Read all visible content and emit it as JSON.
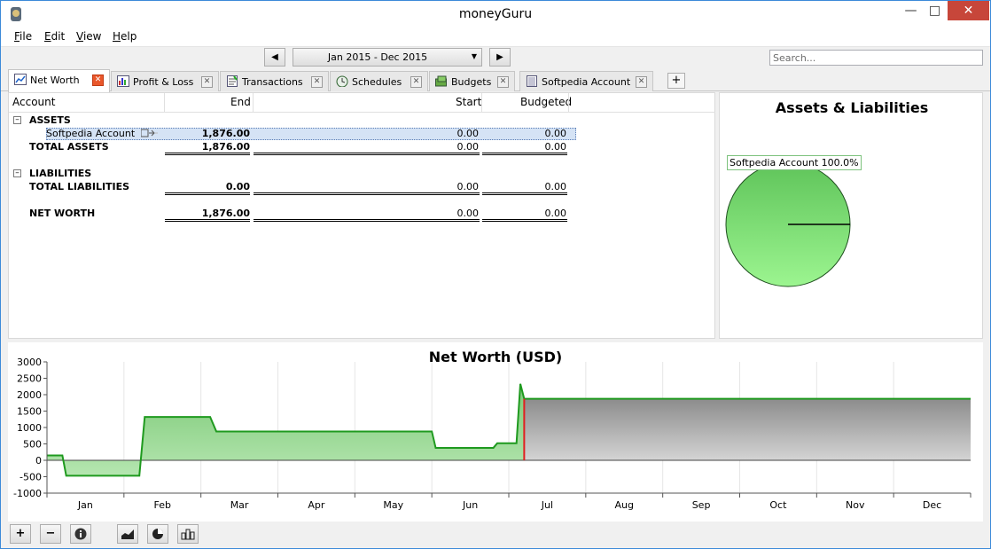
{
  "window": {
    "title": "moneyGuru"
  },
  "menu": [
    {
      "label": "File",
      "mnemonic": "F",
      "rest": "ile"
    },
    {
      "label": "Edit",
      "mnemonic": "E",
      "rest": "dit"
    },
    {
      "label": "View",
      "mnemonic": "V",
      "rest": "iew"
    },
    {
      "label": "Help",
      "mnemonic": "H",
      "rest": "elp"
    }
  ],
  "toolbar": {
    "date_range": "Jan 2015 - Dec 2015",
    "prev_glyph": "◀",
    "next_glyph": "▶",
    "search_placeholder": "Search..."
  },
  "tabs": [
    {
      "label": "Net Worth",
      "icon": "net-worth-icon",
      "active": true
    },
    {
      "label": "Profit & Loss",
      "icon": "profit-loss-icon",
      "active": false
    },
    {
      "label": "Transactions",
      "icon": "transactions-icon",
      "active": false
    },
    {
      "label": "Schedules",
      "icon": "schedules-icon",
      "active": false
    },
    {
      "label": "Budgets",
      "icon": "budgets-icon",
      "active": false
    },
    {
      "label": "Softpedia Account",
      "icon": "account-icon",
      "active": false
    }
  ],
  "sheet": {
    "columns": {
      "account": "Account",
      "end": "End",
      "start": "Start",
      "budgeted": "Budgeted"
    },
    "assets": {
      "group": "ASSETS",
      "accounts": [
        {
          "name": "Softpedia Account",
          "end": "1,876.00",
          "start": "0.00",
          "budgeted": "0.00"
        }
      ],
      "total": {
        "label": "TOTAL ASSETS",
        "end": "1,876.00",
        "start": "0.00",
        "budgeted": "0.00"
      }
    },
    "liabilities": {
      "group": "LIABILITIES",
      "total": {
        "label": "TOTAL LIABILITIES",
        "end": "0.00",
        "start": "0.00",
        "budgeted": "0.00"
      }
    },
    "net_worth": {
      "label": "NET WORTH",
      "end": "1,876.00",
      "start": "0.00",
      "budgeted": "0.00"
    }
  },
  "pie_chart": {
    "title": "Assets & Liabilities",
    "label": "Softpedia Account 100.0%",
    "slices": [
      {
        "name": "Softpedia Account",
        "percent": 100.0,
        "color": "#7fd97a"
      }
    ]
  },
  "chart_data": {
    "type": "area",
    "title": "Net Worth (USD)",
    "ylim": [
      -1000,
      3000
    ],
    "yticks": [
      3000,
      2500,
      2000,
      1500,
      1000,
      500,
      0,
      -500,
      -1000
    ],
    "months": [
      "Jan",
      "Feb",
      "Mar",
      "Apr",
      "May",
      "Jun",
      "Jul",
      "Aug",
      "Sep",
      "Oct",
      "Nov",
      "Dec"
    ],
    "x_unit": "month",
    "x_range": [
      0,
      12
    ],
    "series": [
      {
        "points": [
          [
            0,
            150
          ],
          [
            0.2,
            150
          ],
          [
            0.25,
            -470
          ],
          [
            1.2,
            -470
          ],
          [
            1.27,
            1320
          ],
          [
            2.12,
            1320
          ],
          [
            2.2,
            880
          ],
          [
            5.0,
            880
          ],
          [
            5.05,
            380
          ],
          [
            5.8,
            380
          ],
          [
            5.85,
            520
          ],
          [
            6.1,
            520
          ],
          [
            6.15,
            2330
          ],
          [
            6.2,
            1876
          ]
        ]
      },
      {
        "points": [
          [
            6.2,
            1876
          ],
          [
            12,
            1876
          ]
        ]
      }
    ],
    "today": 6.2,
    "past_fill": "#8fd28a",
    "future_fill": "#a9a9a9",
    "line_color": "#1f9a1f",
    "today_color": "#e02020",
    "grid": true
  }
}
